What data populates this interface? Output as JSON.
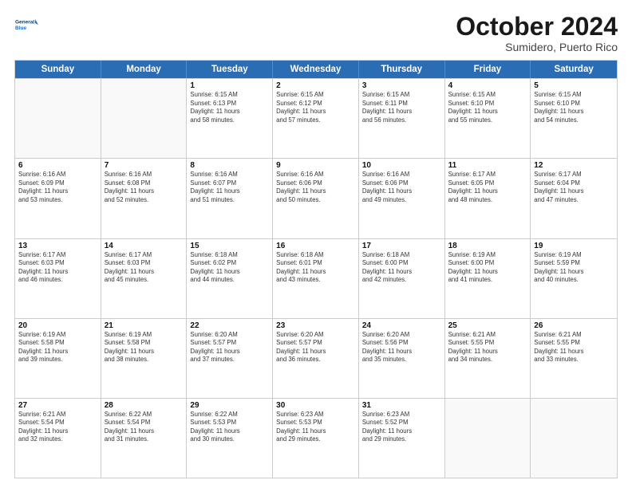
{
  "logo": {
    "line1": "General",
    "line2": "Blue"
  },
  "header": {
    "month": "October 2024",
    "location": "Sumidero, Puerto Rico"
  },
  "weekdays": [
    "Sunday",
    "Monday",
    "Tuesday",
    "Wednesday",
    "Thursday",
    "Friday",
    "Saturday"
  ],
  "rows": [
    [
      {
        "day": "",
        "info": ""
      },
      {
        "day": "",
        "info": ""
      },
      {
        "day": "1",
        "info": "Sunrise: 6:15 AM\nSunset: 6:13 PM\nDaylight: 11 hours\nand 58 minutes."
      },
      {
        "day": "2",
        "info": "Sunrise: 6:15 AM\nSunset: 6:12 PM\nDaylight: 11 hours\nand 57 minutes."
      },
      {
        "day": "3",
        "info": "Sunrise: 6:15 AM\nSunset: 6:11 PM\nDaylight: 11 hours\nand 56 minutes."
      },
      {
        "day": "4",
        "info": "Sunrise: 6:15 AM\nSunset: 6:10 PM\nDaylight: 11 hours\nand 55 minutes."
      },
      {
        "day": "5",
        "info": "Sunrise: 6:15 AM\nSunset: 6:10 PM\nDaylight: 11 hours\nand 54 minutes."
      }
    ],
    [
      {
        "day": "6",
        "info": "Sunrise: 6:16 AM\nSunset: 6:09 PM\nDaylight: 11 hours\nand 53 minutes."
      },
      {
        "day": "7",
        "info": "Sunrise: 6:16 AM\nSunset: 6:08 PM\nDaylight: 11 hours\nand 52 minutes."
      },
      {
        "day": "8",
        "info": "Sunrise: 6:16 AM\nSunset: 6:07 PM\nDaylight: 11 hours\nand 51 minutes."
      },
      {
        "day": "9",
        "info": "Sunrise: 6:16 AM\nSunset: 6:06 PM\nDaylight: 11 hours\nand 50 minutes."
      },
      {
        "day": "10",
        "info": "Sunrise: 6:16 AM\nSunset: 6:06 PM\nDaylight: 11 hours\nand 49 minutes."
      },
      {
        "day": "11",
        "info": "Sunrise: 6:17 AM\nSunset: 6:05 PM\nDaylight: 11 hours\nand 48 minutes."
      },
      {
        "day": "12",
        "info": "Sunrise: 6:17 AM\nSunset: 6:04 PM\nDaylight: 11 hours\nand 47 minutes."
      }
    ],
    [
      {
        "day": "13",
        "info": "Sunrise: 6:17 AM\nSunset: 6:03 PM\nDaylight: 11 hours\nand 46 minutes."
      },
      {
        "day": "14",
        "info": "Sunrise: 6:17 AM\nSunset: 6:03 PM\nDaylight: 11 hours\nand 45 minutes."
      },
      {
        "day": "15",
        "info": "Sunrise: 6:18 AM\nSunset: 6:02 PM\nDaylight: 11 hours\nand 44 minutes."
      },
      {
        "day": "16",
        "info": "Sunrise: 6:18 AM\nSunset: 6:01 PM\nDaylight: 11 hours\nand 43 minutes."
      },
      {
        "day": "17",
        "info": "Sunrise: 6:18 AM\nSunset: 6:00 PM\nDaylight: 11 hours\nand 42 minutes."
      },
      {
        "day": "18",
        "info": "Sunrise: 6:19 AM\nSunset: 6:00 PM\nDaylight: 11 hours\nand 41 minutes."
      },
      {
        "day": "19",
        "info": "Sunrise: 6:19 AM\nSunset: 5:59 PM\nDaylight: 11 hours\nand 40 minutes."
      }
    ],
    [
      {
        "day": "20",
        "info": "Sunrise: 6:19 AM\nSunset: 5:58 PM\nDaylight: 11 hours\nand 39 minutes."
      },
      {
        "day": "21",
        "info": "Sunrise: 6:19 AM\nSunset: 5:58 PM\nDaylight: 11 hours\nand 38 minutes."
      },
      {
        "day": "22",
        "info": "Sunrise: 6:20 AM\nSunset: 5:57 PM\nDaylight: 11 hours\nand 37 minutes."
      },
      {
        "day": "23",
        "info": "Sunrise: 6:20 AM\nSunset: 5:57 PM\nDaylight: 11 hours\nand 36 minutes."
      },
      {
        "day": "24",
        "info": "Sunrise: 6:20 AM\nSunset: 5:56 PM\nDaylight: 11 hours\nand 35 minutes."
      },
      {
        "day": "25",
        "info": "Sunrise: 6:21 AM\nSunset: 5:55 PM\nDaylight: 11 hours\nand 34 minutes."
      },
      {
        "day": "26",
        "info": "Sunrise: 6:21 AM\nSunset: 5:55 PM\nDaylight: 11 hours\nand 33 minutes."
      }
    ],
    [
      {
        "day": "27",
        "info": "Sunrise: 6:21 AM\nSunset: 5:54 PM\nDaylight: 11 hours\nand 32 minutes."
      },
      {
        "day": "28",
        "info": "Sunrise: 6:22 AM\nSunset: 5:54 PM\nDaylight: 11 hours\nand 31 minutes."
      },
      {
        "day": "29",
        "info": "Sunrise: 6:22 AM\nSunset: 5:53 PM\nDaylight: 11 hours\nand 30 minutes."
      },
      {
        "day": "30",
        "info": "Sunrise: 6:23 AM\nSunset: 5:53 PM\nDaylight: 11 hours\nand 29 minutes."
      },
      {
        "day": "31",
        "info": "Sunrise: 6:23 AM\nSunset: 5:52 PM\nDaylight: 11 hours\nand 29 minutes."
      },
      {
        "day": "",
        "info": ""
      },
      {
        "day": "",
        "info": ""
      }
    ]
  ]
}
